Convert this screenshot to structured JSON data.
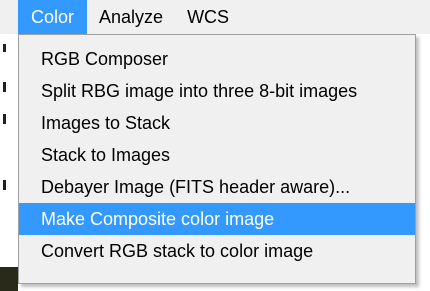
{
  "menubar": {
    "items": [
      {
        "label": "Color",
        "active": true
      },
      {
        "label": "Analyze",
        "active": false
      },
      {
        "label": "WCS",
        "active": false
      }
    ]
  },
  "color_menu": {
    "items": [
      {
        "label": "RGB Composer",
        "highlighted": false
      },
      {
        "label": "Split RBG image into three 8-bit images",
        "highlighted": false
      },
      {
        "label": "Images to Stack",
        "highlighted": false
      },
      {
        "label": "Stack to Images",
        "highlighted": false
      },
      {
        "label": "Debayer Image (FITS header aware)...",
        "highlighted": false
      },
      {
        "label": "Make Composite color image",
        "highlighted": true
      },
      {
        "label": "Convert RGB stack to color image",
        "highlighted": false
      }
    ]
  },
  "colors": {
    "menu_background": "#f0f0f0",
    "highlight": "#3399ff",
    "highlight_text": "#ffffff",
    "text": "#000000"
  }
}
